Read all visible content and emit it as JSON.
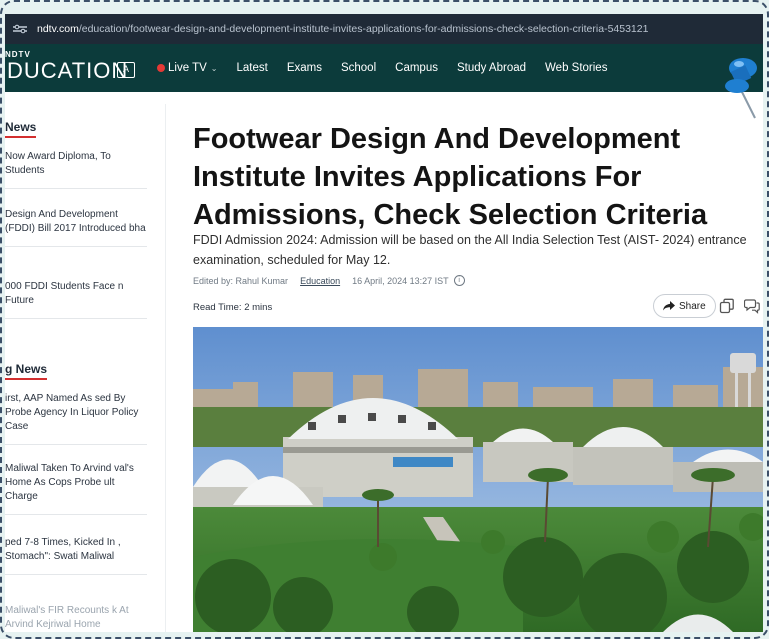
{
  "browser": {
    "url_domain": "ndtv.com",
    "url_path": "/education/footwear-design-and-development-institute-invites-applications-for-admissions-check-selection-criteria-5453121"
  },
  "brand": {
    "small": "NDTV",
    "main": "DUCATION"
  },
  "nav": {
    "live_label": "Live TV",
    "items": [
      "Latest",
      "Exams",
      "School",
      "Campus",
      "Study Abroad",
      "Web Stories"
    ]
  },
  "sidebar": {
    "section1_title": "News",
    "section1_items": [
      "Now Award Diploma, To Students",
      "Design And Development (FDDI) Bill 2017 Introduced bha",
      "000 FDDI Students Face n Future"
    ],
    "section2_title": "g News",
    "section2_items": [
      "irst, AAP Named As sed By Probe Agency In Liquor Policy Case",
      "Maliwal Taken To Arvind val's Home As Cops Probe ult Charge",
      "ped 7-8 Times, Kicked In , Stomach\": Swati Maliwal",
      "Maliwal's FIR Recounts k At Arvind Kejriwal Home"
    ]
  },
  "article": {
    "headline": "Footwear Design And Development Institute Invites Applications For Admissions, Check Selection Criteria",
    "summary": "FDDI Admission 2024: Admission will be based on the All India Selection Test (AIST- 2024) entrance examination, scheduled for May 12.",
    "edited_by": "Edited by: Rahul Kumar",
    "category": "Education",
    "date": "16 April, 2024 13:27 IST",
    "read_time": "Read Time: 2 mins",
    "share_label": "Share"
  },
  "colors": {
    "nav_bg": "#0c3b3b",
    "urlbar_bg": "#1f2a37",
    "accent_red": "#d32f2f",
    "live_dot": "#e53935"
  },
  "icons": [
    "tune-icon",
    "language-icon",
    "pushpin-icon",
    "info-icon",
    "share-icon",
    "copy-icon",
    "comment-icon"
  ]
}
